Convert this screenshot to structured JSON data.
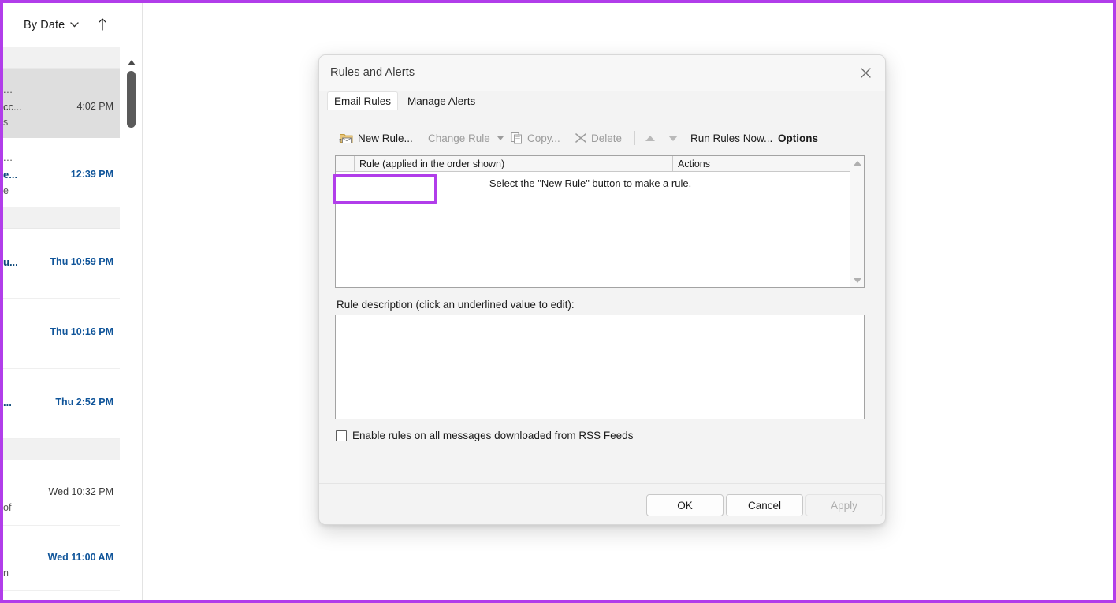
{
  "theme": {
    "annotation_purple": "#b13dea",
    "dialog_bg": "#f3f3f3",
    "unread_blue": "#10559a",
    "selected_row": "#dedede"
  },
  "mail_pane": {
    "sort": {
      "label": "By Date",
      "chevron_icon": "chevron-down-icon",
      "ascending_icon": "arrow-up-icon",
      "ascending_glyph": "↑",
      "chevron_glyph": "⌄"
    },
    "scrollbar": {
      "up_icon": "scroll-up-arrow-icon"
    },
    "items": [
      {
        "top_fragment": "",
        "sender_fragment": "",
        "time": "",
        "bottom_fragment": "",
        "state": "group-separator",
        "unread": false
      },
      {
        "top_fragment": "...",
        "sender_fragment": "cc...",
        "time": "4:02 PM",
        "bottom_fragment": "s",
        "state": "selected",
        "unread": false
      },
      {
        "top_fragment": "...",
        "sender_fragment": "e...",
        "time": "12:39 PM",
        "bottom_fragment": "e",
        "state": "normal",
        "unread": true
      },
      {
        "top_fragment": "",
        "sender_fragment": "",
        "time": "",
        "bottom_fragment": "",
        "state": "group-separator",
        "unread": false
      },
      {
        "top_fragment": "",
        "sender_fragment": "u...",
        "time": "Thu 10:59 PM",
        "bottom_fragment": "",
        "state": "normal",
        "unread": true
      },
      {
        "top_fragment": "",
        "sender_fragment": "",
        "time": "Thu 10:16 PM",
        "bottom_fragment": "",
        "state": "normal",
        "unread": true
      },
      {
        "top_fragment": "",
        "sender_fragment": "...",
        "time": "Thu 2:52 PM",
        "bottom_fragment": "",
        "state": "normal",
        "unread": true
      },
      {
        "top_fragment": "",
        "sender_fragment": "",
        "time": "",
        "bottom_fragment": "",
        "state": "group-separator",
        "unread": false
      },
      {
        "top_fragment": "",
        "sender_fragment": "",
        "time": "Wed 10:32 PM",
        "bottom_fragment": "of",
        "state": "normal",
        "unread": false
      },
      {
        "top_fragment": "",
        "sender_fragment": "",
        "time": "Wed 11:00 AM",
        "bottom_fragment": "n",
        "state": "normal",
        "unread": true
      }
    ]
  },
  "dialog": {
    "title": "Rules and Alerts",
    "close_icon": "close-icon",
    "close_glyph": "✕",
    "tabs": [
      {
        "label": "Email Rules",
        "active": true
      },
      {
        "label": "Manage Alerts",
        "active": false
      }
    ],
    "toolbar": {
      "new_rule": {
        "label_pre": "",
        "label_underline": "N",
        "label_post": "ew Rule...",
        "icon": "new-rule-icon",
        "disabled": false,
        "highlighted": true
      },
      "change_rule": {
        "label_underline": "C",
        "label_post": "hange Rule",
        "icon": "chevron-down-icon",
        "disabled": true
      },
      "copy": {
        "label_pre": "",
        "label_underline": "C",
        "label_post": "opy...",
        "icon": "copy-icon",
        "disabled": true
      },
      "delete": {
        "label_underline": "D",
        "label_post": "elete",
        "icon": "delete-x-icon",
        "disabled": true
      },
      "move_up": {
        "icon": "move-up-arrow-icon",
        "disabled": true
      },
      "move_down": {
        "icon": "move-down-arrow-icon",
        "disabled": true
      },
      "run_rules_now": {
        "label_underline": "R",
        "label_post": "un Rules Now...",
        "disabled": false
      },
      "options": {
        "label_underline": "O",
        "label_post": "ptions",
        "disabled": false
      }
    },
    "rules_list": {
      "columns": [
        {
          "id": "checkbox",
          "label": ""
        },
        {
          "id": "rule",
          "label": "Rule (applied in the order shown)"
        },
        {
          "id": "actions",
          "label": "Actions"
        }
      ],
      "rows": [],
      "empty_message": "Select the \"New Rule\" button to make a rule.",
      "scroll_up_icon": "scroll-up-arrow-icon",
      "scroll_down_icon": "scroll-down-arrow-icon"
    },
    "rule_description": {
      "label": "Rule description (click an underlined value to edit):",
      "value": ""
    },
    "rss_option": {
      "label": "Enable rules on all messages downloaded from RSS Feeds",
      "checked": false
    },
    "footer": {
      "ok": {
        "label": "OK",
        "disabled": false
      },
      "cancel": {
        "label": "Cancel",
        "disabled": false
      },
      "apply": {
        "label": "Apply",
        "disabled": true
      }
    }
  }
}
